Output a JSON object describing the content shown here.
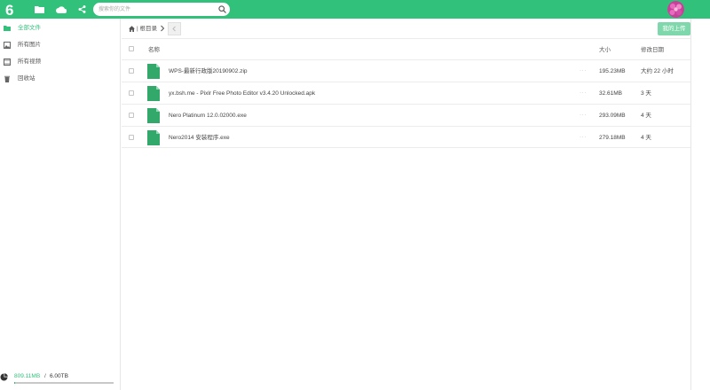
{
  "header": {
    "logo_text": "6",
    "search_placeholder": "搜索你的文件",
    "nav_icons": [
      "folder-icon",
      "cloud-icon",
      "share-icon"
    ],
    "brand_color": "#32c17a"
  },
  "sidebar": {
    "items": [
      {
        "label": "全部文件",
        "icon": "folder-icon",
        "active": true
      },
      {
        "label": "所有图片",
        "icon": "image-icon",
        "active": false
      },
      {
        "label": "所有视频",
        "icon": "video-icon",
        "active": false
      },
      {
        "label": "回收站",
        "icon": "trash-icon",
        "active": false
      }
    ],
    "quota": {
      "used": "809.11MB",
      "separator": "/",
      "total": "6.00TB",
      "used_fraction": 0.0001
    }
  },
  "breadcrumb": {
    "root": "根目录",
    "separator": "|"
  },
  "toolbar": {
    "upload_label": "我的上传"
  },
  "table": {
    "columns": {
      "name": "名称",
      "size": "大小",
      "modified": "修改日期"
    },
    "rows": [
      {
        "name": "WPS-最新行政版20190902.zip",
        "size": "195.23MB",
        "modified": "大约 22 小时"
      },
      {
        "name": "yx.bsh.me - Pixlr Free Photo Editor v3.4.20 Unlocked.apk",
        "size": "32.61MB",
        "modified": "3 天"
      },
      {
        "name": "Nero Platinum 12.0.02000.exe",
        "size": "293.09MB",
        "modified": "4 天"
      },
      {
        "name": "Nero2014 安装程序.exe",
        "size": "279.18MB",
        "modified": "4 天"
      }
    ],
    "more_glyph": "···"
  }
}
